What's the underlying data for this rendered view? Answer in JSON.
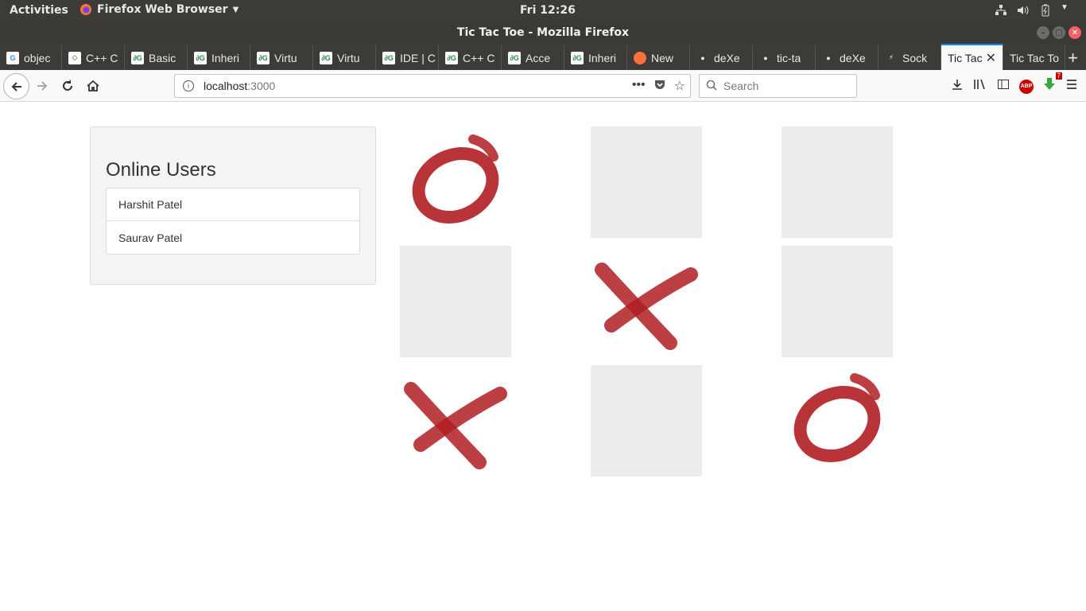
{
  "system": {
    "activities": "Activities",
    "app_menu": "Firefox Web Browser",
    "clock": "Fri 12:26"
  },
  "window": {
    "title": "Tic Tac Toe - Mozilla Firefox"
  },
  "tabs": [
    {
      "label": "objec",
      "icon": "google-icon"
    },
    {
      "label": "C++ C",
      "icon": "cpp-icon"
    },
    {
      "label": "Basic",
      "icon": "geeksforgeeks-icon"
    },
    {
      "label": "Inheri",
      "icon": "geeksforgeeks-icon"
    },
    {
      "label": "Virtu",
      "icon": "geeksforgeeks-icon"
    },
    {
      "label": "Virtu",
      "icon": "geeksforgeeks-icon"
    },
    {
      "label": "IDE | C",
      "icon": "geeksforgeeks-icon"
    },
    {
      "label": "C++ C",
      "icon": "geeksforgeeks-icon"
    },
    {
      "label": "Acce",
      "icon": "geeksforgeeks-icon"
    },
    {
      "label": "Inheri",
      "icon": "geeksforgeeks-icon"
    },
    {
      "label": "New",
      "icon": "firefox-icon"
    },
    {
      "label": "deXe",
      "icon": "github-icon"
    },
    {
      "label": "tic-ta",
      "icon": "github-icon"
    },
    {
      "label": "deXe",
      "icon": "github-icon"
    },
    {
      "label": "Sock",
      "icon": "socketio-icon"
    },
    {
      "label": "Tic Tac",
      "icon": "",
      "active": true
    },
    {
      "label": "Tic Tac To",
      "icon": ""
    }
  ],
  "navbar": {
    "url_host": "localhost",
    "url_port": ":3000",
    "search_placeholder": "Search",
    "download_badge": "7"
  },
  "online_users": {
    "title": "Online Users",
    "users": [
      "Harshit Patel",
      "Saurav Patel"
    ]
  },
  "board": {
    "cells": [
      "O",
      "",
      "",
      "",
      "X",
      "",
      "X",
      "",
      "O"
    ],
    "mark_color": "#b01e22"
  }
}
